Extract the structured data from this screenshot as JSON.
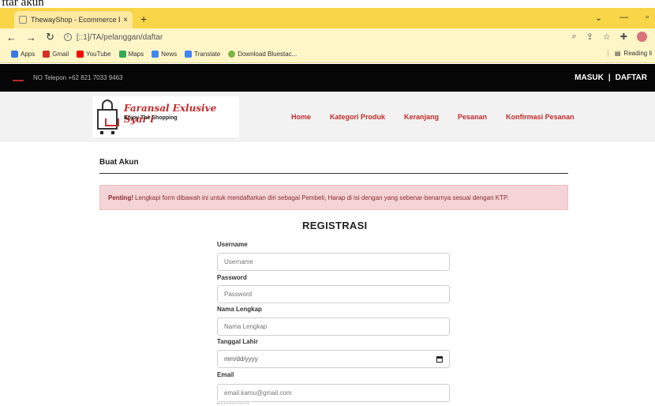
{
  "caption": "ftar akun",
  "browser": {
    "tab_title": "ThewayShop - Ecommerce Boot:",
    "tab_close": "×",
    "new_tab": "+",
    "url": "[::1]/TA/pelanggan/daftar",
    "reading_list": "Reading li"
  },
  "bookmarks": [
    {
      "label": "Apps",
      "color": "#3b78e7"
    },
    {
      "label": "Gmail",
      "color": "#d93025"
    },
    {
      "label": "YouTube",
      "color": "#ff0000"
    },
    {
      "label": "Maps",
      "color": "#34a853"
    },
    {
      "label": "News",
      "color": "#4285f4"
    },
    {
      "label": "Translate",
      "color": "#4285f4"
    },
    {
      "label": "Download Bluestac...",
      "color": "#7cb342"
    }
  ],
  "topbar": {
    "phone": "NO Telepon +62 821 7033 9463",
    "login": "MASUK",
    "separator": "|",
    "register": "DAFTAR"
  },
  "header": {
    "brand": "Faransal Exlusive Syar'i",
    "tagline": "Enjoy The Shopping",
    "menu": [
      "Home",
      "Kategori Produk",
      "Keranjang",
      "Pesanan",
      "Konfirmasi Pesanan"
    ]
  },
  "page": {
    "section_title": "Buat Akun",
    "alert_strong": "Penting!",
    "alert_text": "Lengkapi form dibawah ini untuk mendaftarkan diri sebagai Pembeli, Harap di isi dengan yang sebenar-benarnya sesuai dengan KTP.",
    "form_title": "REGISTRASI"
  },
  "form": {
    "username_label": "Username",
    "username_placeholder": "Username",
    "password_label": "Password",
    "password_placeholder": "Password",
    "fullname_label": "Nama Lengkap",
    "fullname_placeholder": "Nama Lengkap",
    "birthdate_label": "Tanggal Lahir",
    "birthdate_value": "mm/dd/yyyy",
    "email_label": "Email",
    "email_placeholder": "email.kamu@gmail.com"
  },
  "colors": {
    "accent": "#c42a2a",
    "alert_bg": "#f4d4d6",
    "tab_bar": "#f9d548"
  }
}
